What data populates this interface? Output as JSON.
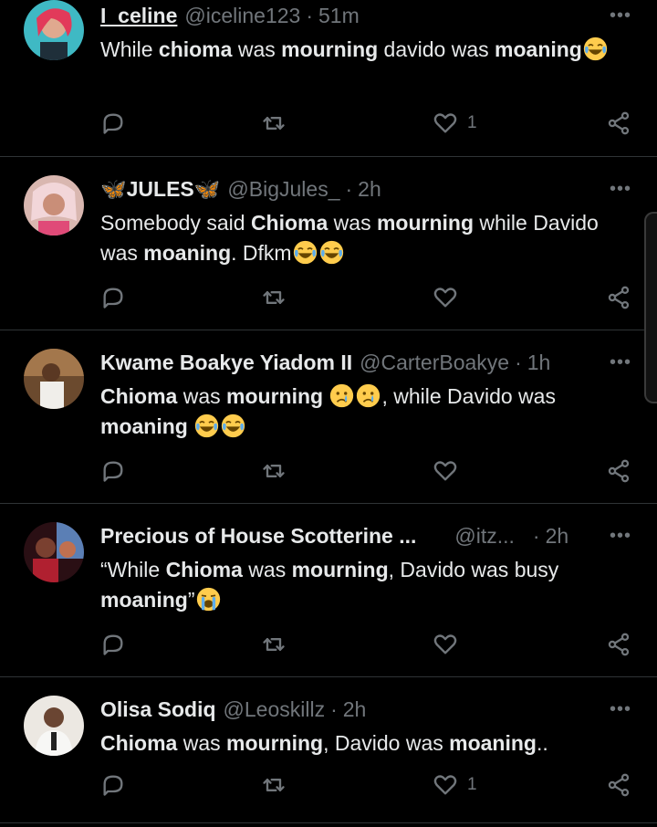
{
  "colors": {
    "background": "#000000",
    "text": "#e7e9ea",
    "muted": "#71767b",
    "divider": "#2f3336"
  },
  "icons": {
    "reply": "reply-icon",
    "retweet": "retweet-icon",
    "like": "heart-icon",
    "share": "share-icon",
    "more": "more-icon"
  },
  "tweets": [
    {
      "name": "I_celine",
      "handle": "@iceline123",
      "time": "51m",
      "more": "•••",
      "segments": [
        {
          "t": "While "
        },
        {
          "t": "chioma",
          "b": true
        },
        {
          "t": " was "
        },
        {
          "t": "mourning",
          "b": true
        },
        {
          "t": " davido was "
        },
        {
          "t": "moaning",
          "b": true
        },
        {
          "e": "joy"
        }
      ],
      "likes": "1"
    },
    {
      "name": "JULES",
      "name_prefix": "🦋",
      "name_suffix": "🦋",
      "handle": "@BigJules_",
      "time": "2h",
      "more": "•••",
      "segments": [
        {
          "t": "Somebody said "
        },
        {
          "t": "Chioma",
          "b": true
        },
        {
          "t": " was "
        },
        {
          "t": "mourning",
          "b": true
        },
        {
          "t": " while Davido was "
        },
        {
          "t": "moaning",
          "b": true
        },
        {
          "t": ". Dfkm"
        },
        {
          "e": "joy"
        },
        {
          "e": "joy"
        }
      ],
      "likes": ""
    },
    {
      "name": "Kwame Boakye Yiadom II",
      "handle": "@CarterBoakye",
      "time": "1h",
      "more": "•••",
      "segments": [
        {
          "t": "Chioma",
          "b": true
        },
        {
          "t": " was "
        },
        {
          "t": "mourning",
          "b": true
        },
        {
          "t": " "
        },
        {
          "e": "cry"
        },
        {
          "e": "cry"
        },
        {
          "t": ", while Davido was "
        },
        {
          "t": "moaning",
          "b": true
        },
        {
          "t": " "
        },
        {
          "e": "joy"
        },
        {
          "e": "joy"
        }
      ],
      "likes": ""
    },
    {
      "name": "Precious of House Scotterine ...",
      "handle": "@itz...",
      "time": "2h",
      "more": "•••",
      "segments": [
        {
          "t": "“While "
        },
        {
          "t": "Chioma",
          "b": true
        },
        {
          "t": " was "
        },
        {
          "t": "mourning",
          "b": true
        },
        {
          "t": ", Davido was busy "
        },
        {
          "t": "moaning",
          "b": true
        },
        {
          "t": "”"
        },
        {
          "e": "sob"
        }
      ],
      "likes": ""
    },
    {
      "name": "Olisa Sodiq",
      "handle": "@Leoskillz",
      "time": "2h",
      "more": "•••",
      "segments": [
        {
          "t": "Chioma",
          "b": true
        },
        {
          "t": " was "
        },
        {
          "t": "mourning",
          "b": true
        },
        {
          "t": ",  Davido was "
        },
        {
          "t": "moaning",
          "b": true
        },
        {
          "t": ".."
        }
      ],
      "likes": "1"
    }
  ]
}
